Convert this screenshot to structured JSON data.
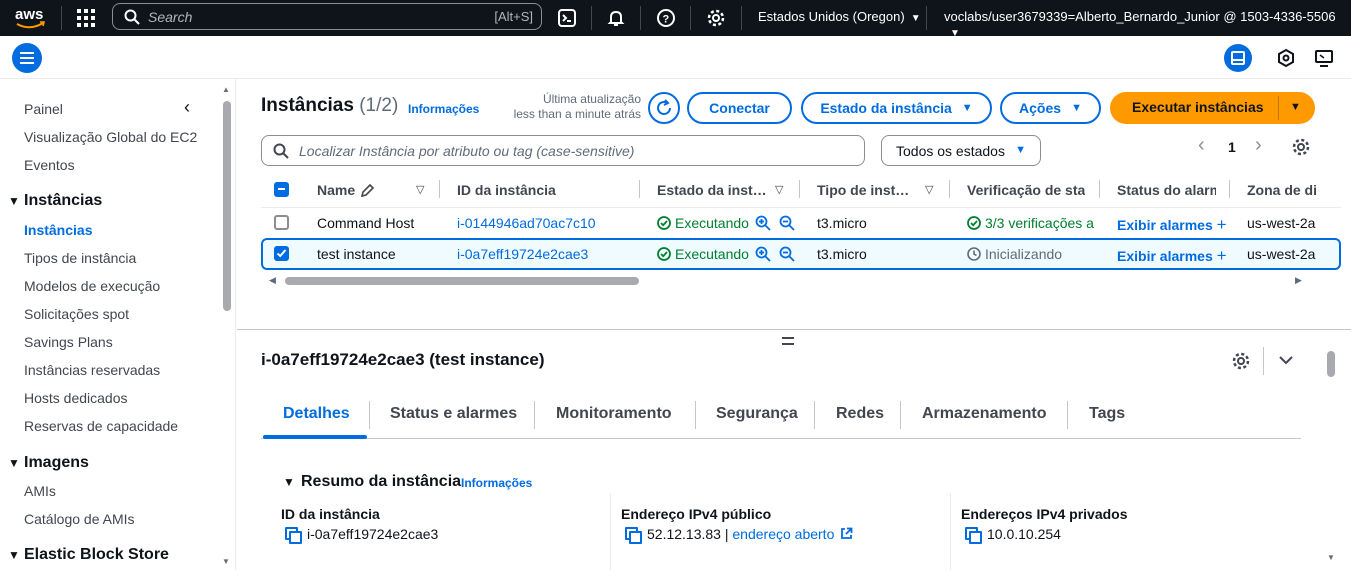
{
  "topbar": {
    "logo_text": "aws",
    "search_placeholder": "Search",
    "search_shortcut": "[Alt+S]",
    "region": "Estados Unidos (Oregon)",
    "account": "voclabs/user3679339=Alberto_Bernardo_Junior @ 1503-4336-5506",
    "icons": [
      "grid-icon",
      "search-icon",
      "cloudshell-icon",
      "bell-icon",
      "help-icon",
      "gear-icon"
    ]
  },
  "sidebar": {
    "top_items": [
      {
        "label": "Painel"
      },
      {
        "label": "Visualização Global do EC2"
      },
      {
        "label": "Eventos"
      }
    ],
    "sections": [
      {
        "title": "Instâncias",
        "items": [
          "Instâncias",
          "Tipos de instância",
          "Modelos de execução",
          "Solicitações spot",
          "Savings Plans",
          "Instâncias reservadas",
          "Hosts dedicados",
          "Reservas de capacidade"
        ]
      },
      {
        "title": "Imagens",
        "items": [
          "AMIs",
          "Catálogo de AMIs"
        ]
      },
      {
        "title": "Elastic Block Store",
        "items": []
      }
    ]
  },
  "instances": {
    "title": "Instâncias",
    "count": "(1/2)",
    "info": "Informações",
    "last_update_label": "Última atualização",
    "last_update_value": "less than a minute atrás",
    "connect": "Conectar",
    "state_btn": "Estado da instância",
    "actions_btn": "Ações",
    "launch_btn": "Executar instâncias",
    "filter_placeholder": "Localizar Instância por atributo ou tag (case-sensitive)",
    "state_filter": "Todos os estados",
    "page": "1",
    "columns": [
      "Name",
      "ID da instância",
      "Estado da inst…",
      "Tipo de inst…",
      "Verificação de stat",
      "Status do alarm",
      "Zona de di"
    ],
    "rows": [
      {
        "selected": false,
        "name": "Command Host",
        "id": "i-0144946ad70ac7c10",
        "state": "Executando",
        "type": "t3.micro",
        "check": "3/3 verificações a",
        "alarm": "Exibir alarmes",
        "zone": "us-west-2a"
      },
      {
        "selected": true,
        "name": "test instance",
        "id": "i-0a7eff19724e2cae3",
        "state": "Executando",
        "type": "t3.micro",
        "check": "Inicializando",
        "alarm": "Exibir alarmes",
        "zone": "us-west-2a"
      }
    ]
  },
  "detail": {
    "title": "i-0a7eff19724e2cae3 (test instance)",
    "tabs": [
      "Detalhes",
      "Status e alarmes",
      "Monitoramento",
      "Segurança",
      "Redes",
      "Armazenamento",
      "Tags"
    ],
    "section_title": "Resumo da instância",
    "section_info": "Informações",
    "fields": [
      {
        "label": "ID da instância",
        "value": "i-0a7eff19724e2cae3"
      },
      {
        "label": "Endereço IPv4 público",
        "value": "52.12.13.83",
        "link": "endereço aberto"
      },
      {
        "label": "Endereços IPv4 privados",
        "value": "10.0.10.254"
      }
    ]
  },
  "colors": {
    "accent": "#006ce0",
    "primary": "#ff9900",
    "success": "#00802f",
    "topbar": "#0f141a"
  }
}
